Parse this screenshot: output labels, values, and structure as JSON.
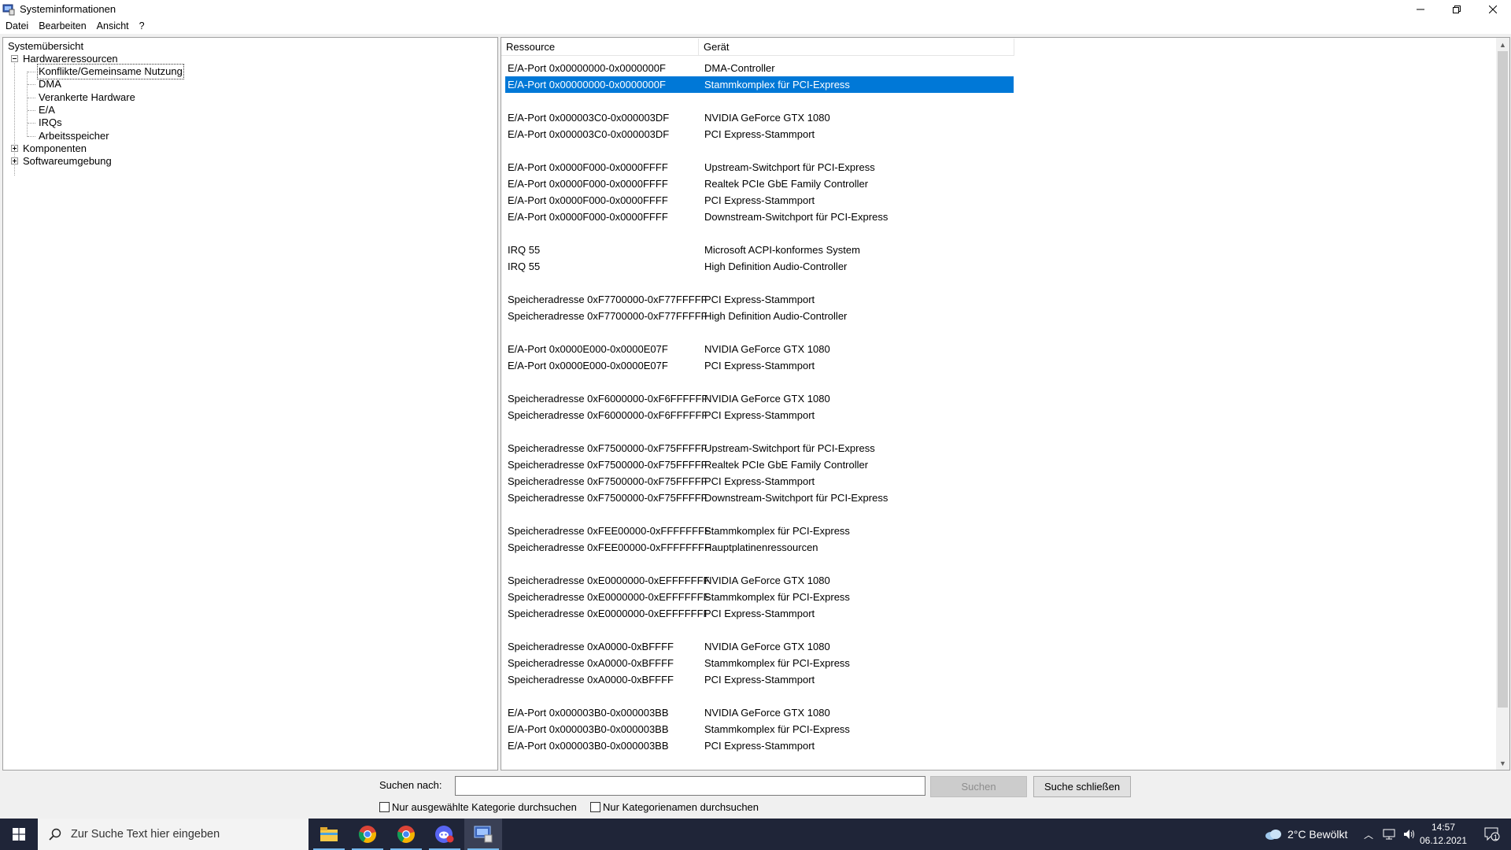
{
  "window": {
    "title": "Systeminformationen"
  },
  "menu": [
    "Datei",
    "Bearbeiten",
    "Ansicht",
    "?"
  ],
  "tree": {
    "root": "Systemübersicht",
    "hardware": "Hardwareressourcen",
    "hardware_children": [
      "Konflikte/Gemeinsame Nutzung",
      "DMA",
      "Verankerte Hardware",
      "E/A",
      "IRQs",
      "Arbeitsspeicher"
    ],
    "components": "Komponenten",
    "software": "Softwareumgebung"
  },
  "list": {
    "columns": [
      "Ressource",
      "Gerät"
    ],
    "rows": [
      {
        "res": "E/A-Port 0x00000000-0x0000000F",
        "dev": "DMA-Controller"
      },
      {
        "res": "E/A-Port 0x00000000-0x0000000F",
        "dev": "Stammkomplex für PCI-Express",
        "selected": true
      },
      {
        "res": "",
        "dev": ""
      },
      {
        "res": "E/A-Port 0x000003C0-0x000003DF",
        "dev": "NVIDIA GeForce GTX 1080"
      },
      {
        "res": "E/A-Port 0x000003C0-0x000003DF",
        "dev": "PCI Express-Stammport"
      },
      {
        "res": "",
        "dev": ""
      },
      {
        "res": "E/A-Port 0x0000F000-0x0000FFFF",
        "dev": "Upstream-Switchport für PCI-Express"
      },
      {
        "res": "E/A-Port 0x0000F000-0x0000FFFF",
        "dev": "Realtek PCIe GbE Family Controller"
      },
      {
        "res": "E/A-Port 0x0000F000-0x0000FFFF",
        "dev": "PCI Express-Stammport"
      },
      {
        "res": "E/A-Port 0x0000F000-0x0000FFFF",
        "dev": "Downstream-Switchport für PCI-Express"
      },
      {
        "res": "",
        "dev": ""
      },
      {
        "res": "IRQ 55",
        "dev": "Microsoft ACPI-konformes System"
      },
      {
        "res": "IRQ 55",
        "dev": "High Definition Audio-Controller"
      },
      {
        "res": "",
        "dev": ""
      },
      {
        "res": "Speicheradresse 0xF7700000-0xF77FFFFF",
        "dev": "PCI Express-Stammport"
      },
      {
        "res": "Speicheradresse 0xF7700000-0xF77FFFFF",
        "dev": "High Definition Audio-Controller"
      },
      {
        "res": "",
        "dev": ""
      },
      {
        "res": "E/A-Port 0x0000E000-0x0000E07F",
        "dev": "NVIDIA GeForce GTX 1080"
      },
      {
        "res": "E/A-Port 0x0000E000-0x0000E07F",
        "dev": "PCI Express-Stammport"
      },
      {
        "res": "",
        "dev": ""
      },
      {
        "res": "Speicheradresse 0xF6000000-0xF6FFFFFF",
        "dev": "NVIDIA GeForce GTX 1080"
      },
      {
        "res": "Speicheradresse 0xF6000000-0xF6FFFFFF",
        "dev": "PCI Express-Stammport"
      },
      {
        "res": "",
        "dev": ""
      },
      {
        "res": "Speicheradresse 0xF7500000-0xF75FFFFF",
        "dev": "Upstream-Switchport für PCI-Express"
      },
      {
        "res": "Speicheradresse 0xF7500000-0xF75FFFFF",
        "dev": "Realtek PCIe GbE Family Controller"
      },
      {
        "res": "Speicheradresse 0xF7500000-0xF75FFFFF",
        "dev": "PCI Express-Stammport"
      },
      {
        "res": "Speicheradresse 0xF7500000-0xF75FFFFF",
        "dev": "Downstream-Switchport für PCI-Express"
      },
      {
        "res": "",
        "dev": ""
      },
      {
        "res": "Speicheradresse 0xFEE00000-0xFFFFFFFF",
        "dev": "Stammkomplex für PCI-Express"
      },
      {
        "res": "Speicheradresse 0xFEE00000-0xFFFFFFFF",
        "dev": "Hauptplatinenressourcen"
      },
      {
        "res": "",
        "dev": ""
      },
      {
        "res": "Speicheradresse 0xE0000000-0xEFFFFFFF",
        "dev": "NVIDIA GeForce GTX 1080"
      },
      {
        "res": "Speicheradresse 0xE0000000-0xEFFFFFFF",
        "dev": "Stammkomplex für PCI-Express"
      },
      {
        "res": "Speicheradresse 0xE0000000-0xEFFFFFFF",
        "dev": "PCI Express-Stammport"
      },
      {
        "res": "",
        "dev": ""
      },
      {
        "res": "Speicheradresse 0xA0000-0xBFFFF",
        "dev": "NVIDIA GeForce GTX 1080"
      },
      {
        "res": "Speicheradresse 0xA0000-0xBFFFF",
        "dev": "Stammkomplex für PCI-Express"
      },
      {
        "res": "Speicheradresse 0xA0000-0xBFFFF",
        "dev": "PCI Express-Stammport"
      },
      {
        "res": "",
        "dev": ""
      },
      {
        "res": "E/A-Port 0x000003B0-0x000003BB",
        "dev": "NVIDIA GeForce GTX 1080"
      },
      {
        "res": "E/A-Port 0x000003B0-0x000003BB",
        "dev": "Stammkomplex für PCI-Express"
      },
      {
        "res": "E/A-Port 0x000003B0-0x000003BB",
        "dev": "PCI Express-Stammport"
      }
    ]
  },
  "search": {
    "label": "Suchen nach:",
    "value": "",
    "search_button": "Suchen",
    "close_button": "Suche schließen",
    "checkbox_selected_category": "Nur ausgewählte Kategorie durchsuchen",
    "checkbox_category_names": "Nur Kategorienamen durchsuchen"
  },
  "taskbar": {
    "search_placeholder": "Zur Suche Text hier eingeben",
    "weather": "2°C  Bewölkt",
    "time": "14:57",
    "date": "06.12.2021",
    "notification_count": "1",
    "apps": [
      "file-explorer-icon",
      "chrome-icon",
      "chrome-icon",
      "discord-icon",
      "system-information-icon"
    ]
  },
  "colors": {
    "selection": "#0078d7",
    "taskbar": "#1f2538"
  }
}
